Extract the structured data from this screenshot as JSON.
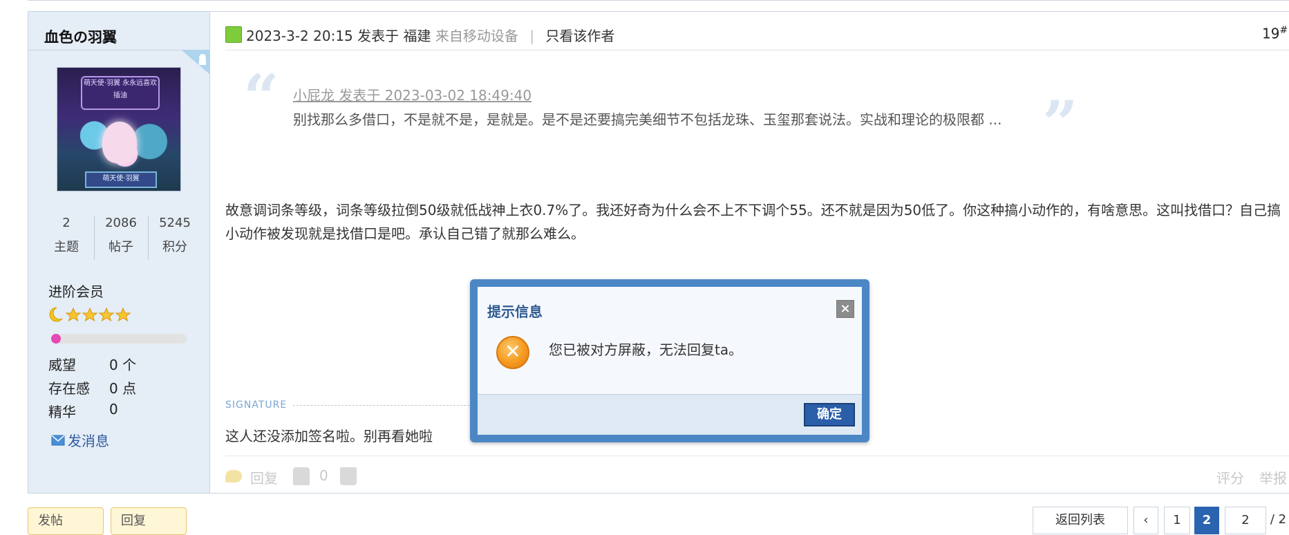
{
  "author": {
    "name": "血色の羽翼",
    "avatar_text_top": "萌天使·羽翼 永永远喜欢插油",
    "avatar_text_bottom": "萌天使·羽翼",
    "stats": [
      {
        "value": "2",
        "label": "主题"
      },
      {
        "value": "2086",
        "label": "帖子"
      },
      {
        "value": "5245",
        "label": "积分"
      }
    ],
    "rank": "进阶会员",
    "level_progress": 0.06,
    "props": [
      {
        "label": "威望",
        "value": "0 个"
      },
      {
        "label": "存在感",
        "value": "0 点"
      },
      {
        "label": "精华",
        "value": "0"
      }
    ],
    "send_message": "发消息"
  },
  "post": {
    "date": "2023-3-2 20:15 发表于",
    "location": "福建",
    "device": "来自移动设备",
    "only_author": "只看该作者",
    "floor": "19",
    "floor_suffix": "#",
    "quote": {
      "meta": "小屁龙 发表于 2023-03-02 18:49:40",
      "text": "别找那么多借口，不是就不是，是就是。是不是还要搞完美细节不包括龙珠、玉玺那套说法。实战和理论的极限都 ..."
    },
    "body": "故意调词条等级，词条等级拉倒50级就低战神上衣0.7%了。我还好奇为什么会不上不下调个55。还不就是因为50低了。你这种搞小动作的，有啥意思。这叫找借口？自己搞小动作被发现就是找借口是吧。承认自己错了就那么难么。",
    "signature_label": "SIGNATURE",
    "signature": "这人还没添加签名啦。别再看她啦",
    "actions": {
      "reply": "回复",
      "likes": "0",
      "rate": "评分",
      "report": "举报"
    }
  },
  "bottom_bar": {
    "left_buttons": [
      "发帖",
      "回复"
    ],
    "back_to_list": "返回列表",
    "pages": [
      "1",
      "2"
    ],
    "current_page": "2",
    "page_input": "2",
    "page_total": "/ 2"
  },
  "dialog": {
    "title": "提示信息",
    "message": "您已被对方屏蔽，无法回复ta。",
    "ok": "确定",
    "close": "×"
  },
  "colors": {
    "dialog_border": "#4c87c5",
    "ok_button": "#2b5ea8",
    "author_bg": "#e5edf6",
    "progress": "#e649b3"
  }
}
